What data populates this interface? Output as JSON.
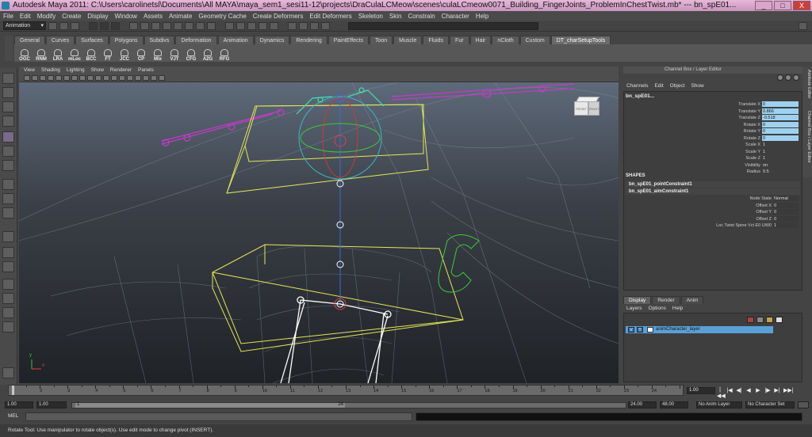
{
  "window": {
    "title": "Autodesk Maya 2011: C:\\Users\\carolinetsl\\Documents\\All MAYA\\maya_sem1_sesi11-12\\projects\\DraCulaLCMeow\\scenes\\culaLCmeow0071_Building_FingerJoints_ProblemInChestTwist.mb*   ---   bn_spE01...",
    "controls": [
      "_",
      "□",
      "X"
    ]
  },
  "menubar": [
    "File",
    "Edit",
    "Modify",
    "Create",
    "Display",
    "Window",
    "Assets",
    "Animate",
    "Geometry Cache",
    "Create Deformers",
    "Edit Deformers",
    "Skeleton",
    "Skin",
    "Constrain",
    "Character",
    "Help"
  ],
  "statusline": {
    "mode": "Animation"
  },
  "shelf": {
    "tabs": [
      "General",
      "Curves",
      "Surfaces",
      "Polygons",
      "Subdivs",
      "Deformation",
      "Animation",
      "Dynamics",
      "Rendering",
      "PaintEffects",
      "Toon",
      "Muscle",
      "Fluids",
      "Fur",
      "Hair",
      "nCloth",
      "Custom",
      "DT_charSetupTools"
    ],
    "active_tab": "DT_charSetupTools",
    "buttons": [
      "OGC",
      "RNM",
      "LRA",
      "mLoc",
      "BCC",
      "FT",
      "JCC",
      "CP",
      "Mix",
      "VJT",
      "CFG",
      "A2G",
      "RFG"
    ]
  },
  "viewport": {
    "menu": [
      "View",
      "Shading",
      "Lighting",
      "Show",
      "Renderer",
      "Panels"
    ],
    "viewcube": {
      "front": "FRONT",
      "side": "RIGHT"
    },
    "axis": {
      "x": "x",
      "y": "y"
    }
  },
  "channel_box": {
    "header": "Channel Box / Layer Editor",
    "menu": [
      "Channels",
      "Edit",
      "Object",
      "Show"
    ],
    "object_name": "bn_spE01...",
    "attributes": [
      {
        "name": "Translate X",
        "value": "0",
        "highlight": true
      },
      {
        "name": "Translate Y",
        "value": "0.866",
        "highlight": true
      },
      {
        "name": "Translate Z",
        "value": "-0.518",
        "highlight": true
      },
      {
        "name": "Rotate X",
        "value": "0",
        "highlight": true
      },
      {
        "name": "Rotate Y",
        "value": "0",
        "highlight": true
      },
      {
        "name": "Rotate Z",
        "value": "0",
        "highlight": true
      },
      {
        "name": "Scale X",
        "value": "1",
        "highlight": false
      },
      {
        "name": "Scale Y",
        "value": "1",
        "highlight": false
      },
      {
        "name": "Scale Z",
        "value": "1",
        "highlight": false
      },
      {
        "name": "Visibility",
        "value": "on",
        "highlight": false
      },
      {
        "name": "Radius",
        "value": "0.5",
        "highlight": false
      }
    ],
    "shapes_title": "SHAPES",
    "shapes": [
      "bn_spE01_pointConstraint1",
      "bn_spE01_aimConstraint1"
    ],
    "constraint_attributes": [
      {
        "name": "Node State",
        "value": "Normal"
      },
      {
        "name": "Offset X",
        "value": "0"
      },
      {
        "name": "Offset Y",
        "value": "0"
      },
      {
        "name": "Offset Z",
        "value": "0"
      },
      {
        "name": "Loc Twist Spine Vct E0 UW0",
        "value": "1"
      }
    ]
  },
  "side_tabs": [
    "Attribute Editor",
    "Channel Box / Layer Editor"
  ],
  "layer_editor": {
    "tabs": [
      "Display",
      "Render",
      "Anim"
    ],
    "active_tab": "Display",
    "menu": [
      "Layers",
      "Options",
      "Help"
    ],
    "layer": {
      "visibility": "V",
      "type": "T",
      "name": "animCharacter_layer"
    }
  },
  "timeline": {
    "ticks": [
      "1",
      "2",
      "3",
      "4",
      "5",
      "6",
      "7",
      "8",
      "9",
      "10",
      "11",
      "12",
      "13",
      "14",
      "15",
      "16",
      "17",
      "18",
      "19",
      "20",
      "21",
      "22",
      "23",
      "24"
    ],
    "current_frame": "1.00",
    "playback": [
      "|◀◀",
      "|◀",
      "◀|",
      "◀",
      "▶",
      "|▶",
      "▶|",
      "▶▶|"
    ]
  },
  "range": {
    "start": "1.00",
    "inner_start": "1.00",
    "slider_start": "1",
    "slider_end": "24",
    "end": "24.00",
    "outer_end": "48.00",
    "anim_layer": "No Anim Layer",
    "character_set": "No Character Set"
  },
  "command_line": {
    "label": "MEL"
  },
  "help_line": "Rotate Tool: Use manipulator to rotate object(s). Use edit mode to change pivot (INSERT).",
  "colors": {
    "title_bar": "#d9a8cc",
    "highlight_field": "#9ed1f0",
    "layer_row": "#5aa0d8",
    "joint_magenta": "#c23cc8",
    "control_yellow": "#e6e65a",
    "control_green": "#3cc83c"
  }
}
